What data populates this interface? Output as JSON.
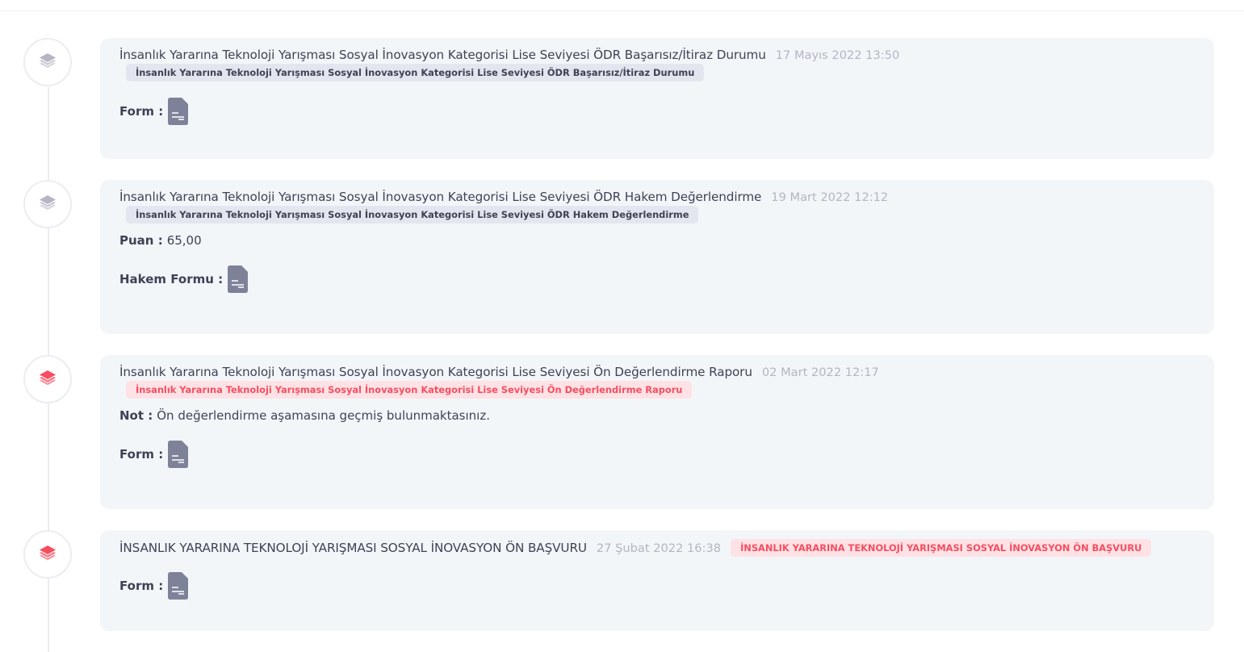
{
  "items": [
    {
      "status": "muted",
      "title": "İnsanlık Yararına Teknoloji Yarışması Sosyal İnovasyon Kategorisi Lise Seviyesi ÖDR Başarısız/İtiraz Durumu",
      "date": "17 Mayıs 2022 13:50",
      "label": "İnsanlık Yararına Teknoloji Yarışması Sosyal İnovasyon Kategorisi Lise Seviyesi ÖDR Başarısız/İtiraz Durumu",
      "form_label": "Form :",
      "icon": "layers-icon",
      "doc_icon": "document-icon"
    },
    {
      "status": "muted",
      "title": "İnsanlık Yararına Teknoloji Yarışması Sosyal İnovasyon Kategorisi Lise Seviyesi ÖDR Hakem Değerlendirme",
      "date": "19 Mart 2022 12:12",
      "label": "İnsanlık Yararına Teknoloji Yarışması Sosyal İnovasyon Kategorisi Lise Seviyesi ÖDR Hakem Değerlendirme",
      "score_key": "Puan :",
      "score_value": "65,00",
      "form_label": "Hakem Formu :",
      "icon": "layers-icon",
      "doc_icon": "document-icon"
    },
    {
      "status": "danger",
      "title": "İnsanlık Yararına Teknoloji Yarışması Sosyal İnovasyon Kategorisi Lise Seviyesi Ön Değerlendirme Raporu",
      "date": "02 Mart 2022 12:17",
      "label": "İnsanlık Yararına Teknoloji Yarışması Sosyal İnovasyon Kategorisi Lise Seviyesi Ön Değerlendirme Raporu",
      "note_key": "Not :",
      "note_value": "Ön değerlendirme aşamasına geçmiş bulunmaktasınız.",
      "form_label": "Form :",
      "icon": "layers-icon",
      "doc_icon": "document-icon"
    },
    {
      "status": "danger",
      "title": "İNSANLIK YARARINA TEKNOLOJİ YARIŞMASI SOSYAL İNOVASYON ÖN BAŞVURU",
      "date": "27 Şubat 2022 16:38",
      "label": "İNSANLIK YARARINA TEKNOLOJİ YARIŞMASI SOSYAL İNOVASYON ÖN BAŞVURU",
      "form_label": "Form :",
      "icon": "layers-icon",
      "doc_icon": "document-icon"
    }
  ],
  "colors": {
    "muted_icon": "#b5b5c3",
    "danger": "#f64e60",
    "danger_light": "#ffe2e5",
    "card_bg": "#f3f6f9",
    "doc_icon": "#7e8299"
  }
}
